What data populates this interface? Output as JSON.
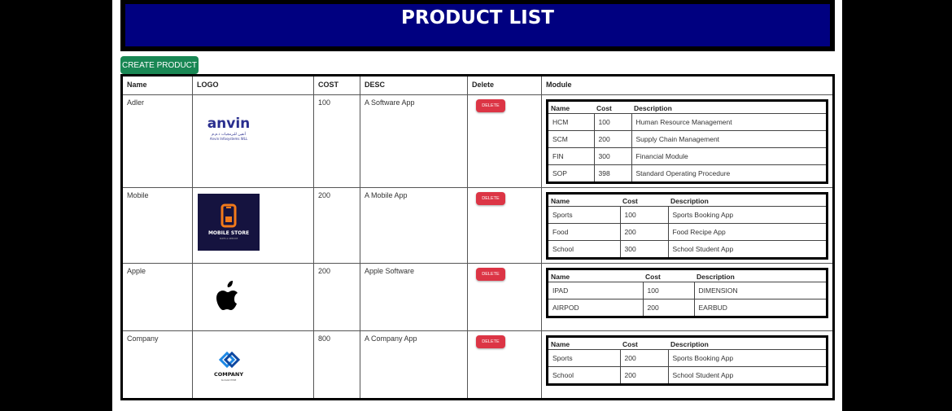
{
  "header": {
    "title": "PRODUCT LIST"
  },
  "toolbar": {
    "create_label": "CREATE PRODUCT"
  },
  "table": {
    "headers": {
      "name": "Name",
      "logo": "LOGO",
      "cost": "COST",
      "desc": "DESC",
      "delete": "Delete",
      "module": "Module"
    },
    "delete_label": "DELETE",
    "module_headers": {
      "name": "Name",
      "cost": "Cost",
      "description": "Description"
    },
    "rows": [
      {
        "name": "Adler",
        "cost": "100",
        "desc": "A Software App",
        "logo": {
          "icon": "anvin-logo-icon",
          "brand": "anvin",
          "arabic": "أنفين للبرمجيات ذ.م.م",
          "tagline": "Anvin Infosystems WLL"
        },
        "modules": [
          {
            "name": "HCM",
            "cost": "100",
            "description": "Human Resource Management"
          },
          {
            "name": "SCM",
            "cost": "200",
            "description": "Supply Chain Management"
          },
          {
            "name": "FIN",
            "cost": "300",
            "description": "Financial Module"
          },
          {
            "name": "SOP",
            "cost": "398",
            "description": "Standard Operating Procedure"
          }
        ]
      },
      {
        "name": "Mobile",
        "cost": "200",
        "desc": "A Mobile App",
        "logo": {
          "icon": "mobile-store-logo-icon",
          "brand": "MOBILE STORE",
          "tagline": "PARTS & SERVICE"
        },
        "modules": [
          {
            "name": "Sports",
            "cost": "100",
            "description": "Sports Booking App"
          },
          {
            "name": "Food",
            "cost": "200",
            "description": "Food Recipe App"
          },
          {
            "name": "School",
            "cost": "300",
            "description": "School Student App"
          }
        ]
      },
      {
        "name": "Apple",
        "cost": "200",
        "desc": "Apple Software",
        "logo": {
          "icon": "apple-logo-icon"
        },
        "modules": [
          {
            "name": "IPAD",
            "cost": "100",
            "description": "DIMENSION"
          },
          {
            "name": "AIRPOD",
            "cost": "200",
            "description": "EARBUD"
          }
        ]
      },
      {
        "name": "Company",
        "cost": "800",
        "desc": "A Company App",
        "logo": {
          "icon": "company-logo-icon",
          "brand": "COMPANY",
          "tagline": "SLOGAN HERE"
        },
        "modules": [
          {
            "name": "Sports",
            "cost": "200",
            "description": "Sports Booking App"
          },
          {
            "name": "School",
            "cost": "200",
            "description": "School Student App"
          }
        ]
      }
    ]
  },
  "colors": {
    "banner": "#000080",
    "create_button": "#198754",
    "delete_button": "#dc3545",
    "mobile_logo_bg": "#15133f",
    "mobile_logo_accent": "#f27a1a",
    "company_logo_blue": "#1e88e5"
  }
}
